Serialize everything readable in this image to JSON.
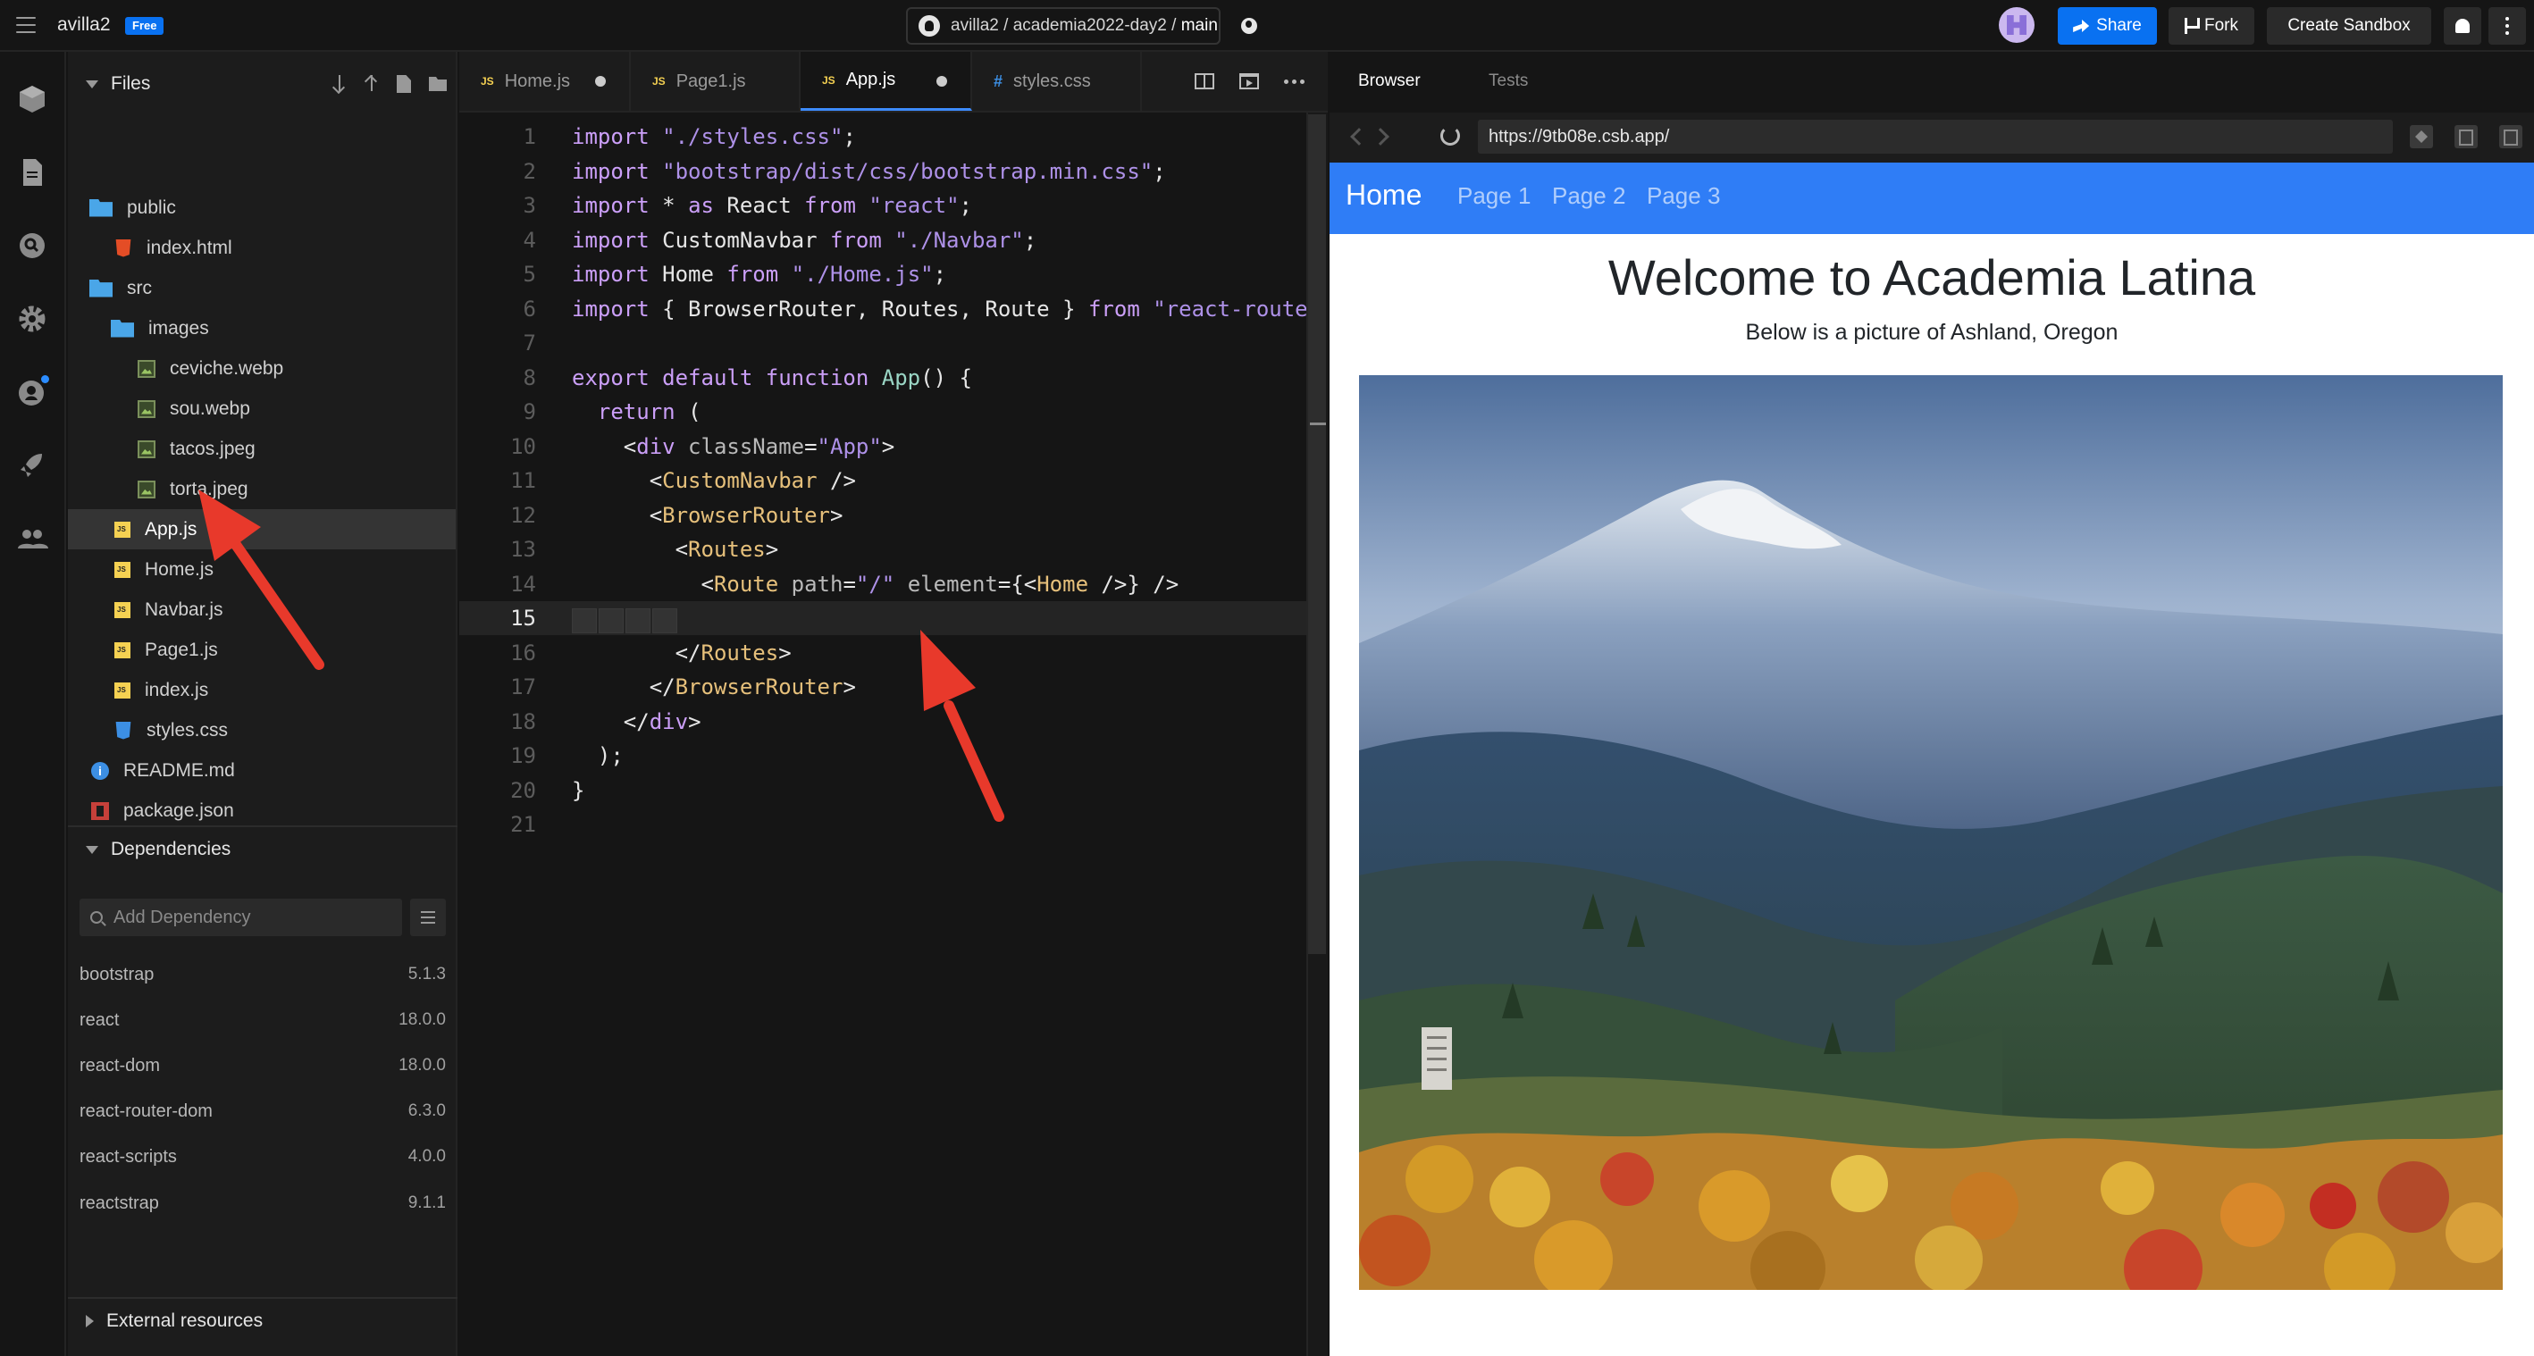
{
  "topbar": {
    "sandbox_name": "avilla2",
    "plan_badge": "Free",
    "repo_path": "avilla2 / academia2022-day2 / ",
    "branch": "main",
    "share_label": "Share",
    "fork_label": "Fork",
    "create_label": "Create Sandbox"
  },
  "sidebar": {
    "files_title": "Files",
    "tree": [
      {
        "name": "public",
        "type": "folder"
      },
      {
        "name": "index.html",
        "type": "html"
      },
      {
        "name": "src",
        "type": "folder"
      },
      {
        "name": "images",
        "type": "folder"
      },
      {
        "name": "ceviche.webp",
        "type": "img"
      },
      {
        "name": "sou.webp",
        "type": "img"
      },
      {
        "name": "tacos.jpeg",
        "type": "img"
      },
      {
        "name": "torta.jpeg",
        "type": "img"
      },
      {
        "name": "App.js",
        "type": "js",
        "active": true,
        "modified": true
      },
      {
        "name": "Home.js",
        "type": "js"
      },
      {
        "name": "Navbar.js",
        "type": "js"
      },
      {
        "name": "Page1.js",
        "type": "js"
      },
      {
        "name": "index.js",
        "type": "js"
      },
      {
        "name": "styles.css",
        "type": "css"
      },
      {
        "name": "README.md",
        "type": "info"
      },
      {
        "name": "package.json",
        "type": "pkg"
      }
    ],
    "dependencies_title": "Dependencies",
    "dep_search_placeholder": "Add Dependency",
    "dependencies": [
      {
        "name": "bootstrap",
        "version": "5.1.3"
      },
      {
        "name": "react",
        "version": "18.0.0"
      },
      {
        "name": "react-dom",
        "version": "18.0.0"
      },
      {
        "name": "react-router-dom",
        "version": "6.3.0"
      },
      {
        "name": "react-scripts",
        "version": "4.0.0"
      },
      {
        "name": "reactstrap",
        "version": "9.1.1"
      }
    ],
    "external_title": "External resources"
  },
  "editor": {
    "tabs": [
      {
        "label": "Home.js",
        "kind": "js",
        "modified": true
      },
      {
        "label": "Page1.js",
        "kind": "js",
        "modified": false
      },
      {
        "label": "App.js",
        "kind": "js",
        "modified": true,
        "active": true
      },
      {
        "label": "styles.css",
        "kind": "css",
        "modified": false
      }
    ],
    "current_line": 15,
    "lines": [
      [
        [
          "kw",
          "import "
        ],
        [
          "str",
          "\"./styles.css\""
        ],
        [
          "txt",
          ";"
        ]
      ],
      [
        [
          "kw",
          "import "
        ],
        [
          "str",
          "\"bootstrap/dist/css/bootstrap.min.css\""
        ],
        [
          "txt",
          ";"
        ]
      ],
      [
        [
          "kw",
          "import "
        ],
        [
          "txt",
          "* "
        ],
        [
          "kw",
          "as "
        ],
        [
          "txt",
          "React "
        ],
        [
          "kw",
          "from "
        ],
        [
          "str",
          "\"react\""
        ],
        [
          "txt",
          ";"
        ]
      ],
      [
        [
          "kw",
          "import "
        ],
        [
          "txt",
          "CustomNavbar "
        ],
        [
          "kw",
          "from "
        ],
        [
          "str",
          "\"./Navbar\""
        ],
        [
          "txt",
          ";"
        ]
      ],
      [
        [
          "kw",
          "import "
        ],
        [
          "txt",
          "Home "
        ],
        [
          "kw",
          "from "
        ],
        [
          "str",
          "\"./Home.js\""
        ],
        [
          "txt",
          ";"
        ]
      ],
      [
        [
          "kw",
          "import "
        ],
        [
          "txt",
          "{ BrowserRouter, Routes, Route } "
        ],
        [
          "kw",
          "from "
        ],
        [
          "str",
          "\"react-router-dom\""
        ],
        [
          "txt",
          ";"
        ]
      ],
      [],
      [
        [
          "kw",
          "export default function "
        ],
        [
          "fn",
          "App"
        ],
        [
          "txt",
          "() {"
        ]
      ],
      [
        [
          "txt",
          "  "
        ],
        [
          "kw",
          "return "
        ],
        [
          "txt",
          "("
        ]
      ],
      [
        [
          "txt",
          "    <"
        ],
        [
          "kw",
          "div "
        ],
        [
          "attr",
          "className"
        ],
        [
          "txt",
          "="
        ],
        [
          "str",
          "\"App\""
        ],
        [
          "txt",
          ">"
        ]
      ],
      [
        [
          "txt",
          "      <"
        ],
        [
          "tag",
          "CustomNavbar"
        ],
        [
          "txt",
          " />"
        ]
      ],
      [
        [
          "txt",
          "      <"
        ],
        [
          "tag",
          "BrowserRouter"
        ],
        [
          "txt",
          ">"
        ]
      ],
      [
        [
          "txt",
          "        <"
        ],
        [
          "tag",
          "Routes"
        ],
        [
          "txt",
          ">"
        ]
      ],
      [
        [
          "txt",
          "          <"
        ],
        [
          "tag",
          "Route "
        ],
        [
          "attr",
          "path"
        ],
        [
          "txt",
          "="
        ],
        [
          "str",
          "\"/\""
        ],
        [
          "txt",
          " "
        ],
        [
          "attr",
          "element"
        ],
        [
          "txt",
          "={<"
        ],
        [
          "tag",
          "Home"
        ],
        [
          "txt",
          " />} />"
        ]
      ],
      [],
      [
        [
          "txt",
          "        </"
        ],
        [
          "tag",
          "Routes"
        ],
        [
          "txt",
          ">"
        ]
      ],
      [
        [
          "txt",
          "      </"
        ],
        [
          "tag",
          "BrowserRouter"
        ],
        [
          "txt",
          ">"
        ]
      ],
      [
        [
          "txt",
          "    </"
        ],
        [
          "kw",
          "div"
        ],
        [
          "txt",
          ">"
        ]
      ],
      [
        [
          "txt",
          "  );"
        ]
      ],
      [
        [
          "txt",
          "}"
        ]
      ],
      []
    ]
  },
  "preview": {
    "tab_browser": "Browser",
    "tab_tests": "Tests",
    "url": "https://9tb08e.csb.app/",
    "site": {
      "brand": "Home",
      "nav_links": [
        "Page 1",
        "Page 2",
        "Page 3"
      ],
      "title": "Welcome to Academia Latina",
      "subtitle": "Below is a picture of Ashland, Oregon"
    }
  },
  "colors": {
    "accent": "#0971f1",
    "site_nav": "#2f7df6",
    "annotation_arrow": "#e8392b"
  }
}
